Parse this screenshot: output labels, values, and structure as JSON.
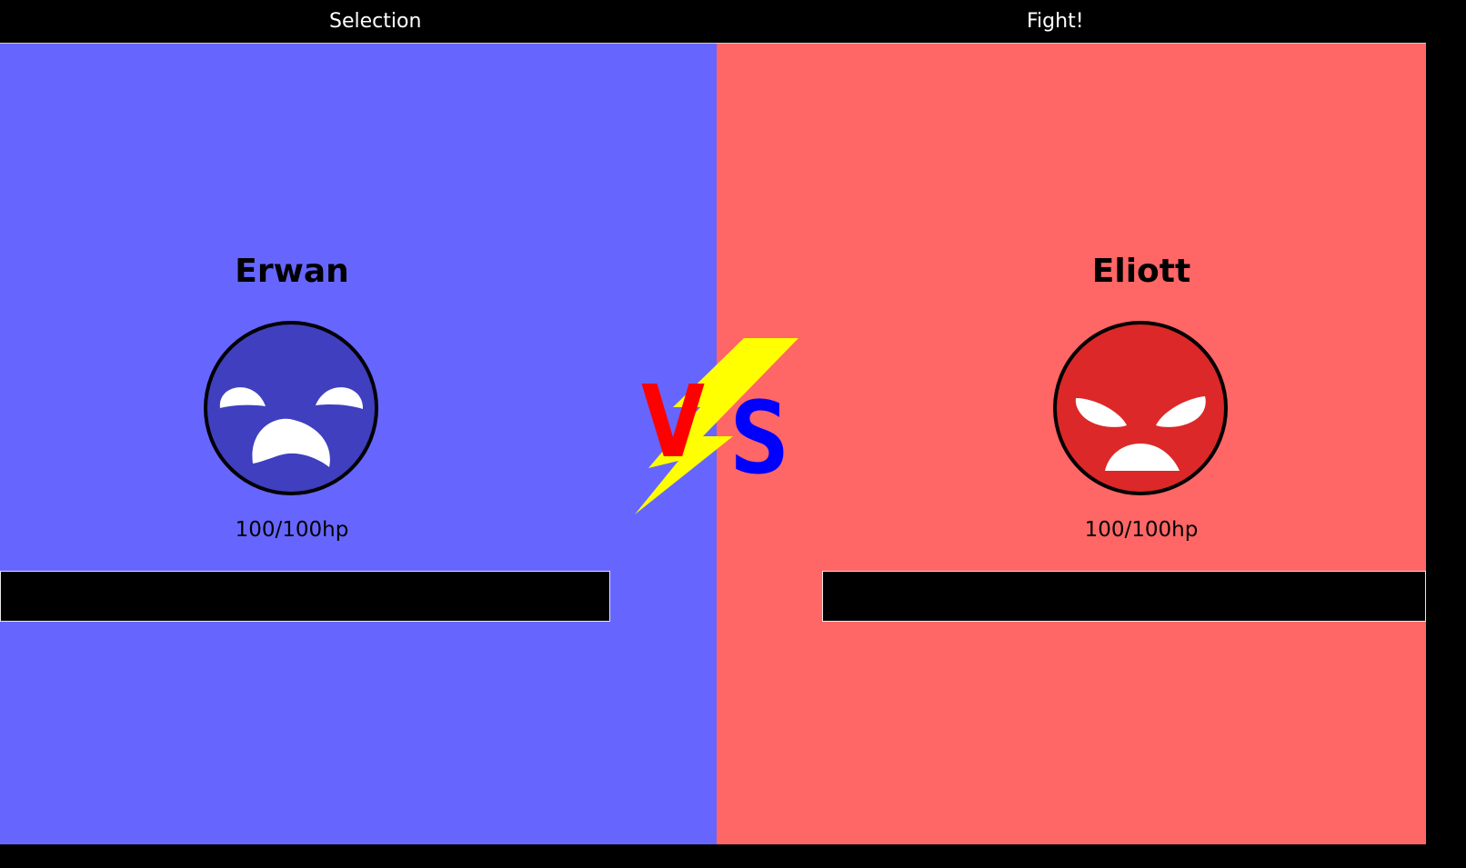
{
  "nav": {
    "selection_label": "Selection",
    "fight_label": "Fight!"
  },
  "colors": {
    "player_panel": "#6666ff",
    "opponent_panel": "#ff6666",
    "player_face": "#3f3fbf",
    "opponent_face": "#dc2828",
    "bolt": "#ffff00",
    "vs_v": "#ff0000",
    "vs_s": "#0000ff"
  },
  "player": {
    "name": "Erwan",
    "hp_text": "100/100hp",
    "hp_fraction": 1.0,
    "face_icon": "sad-face-icon"
  },
  "opponent": {
    "name": "Eliott",
    "hp_text": "100/100hp",
    "hp_fraction": 1.0,
    "face_icon": "angry-face-icon"
  },
  "versus": {
    "v": "V",
    "s": "S",
    "icon": "lightning-bolt-icon"
  }
}
